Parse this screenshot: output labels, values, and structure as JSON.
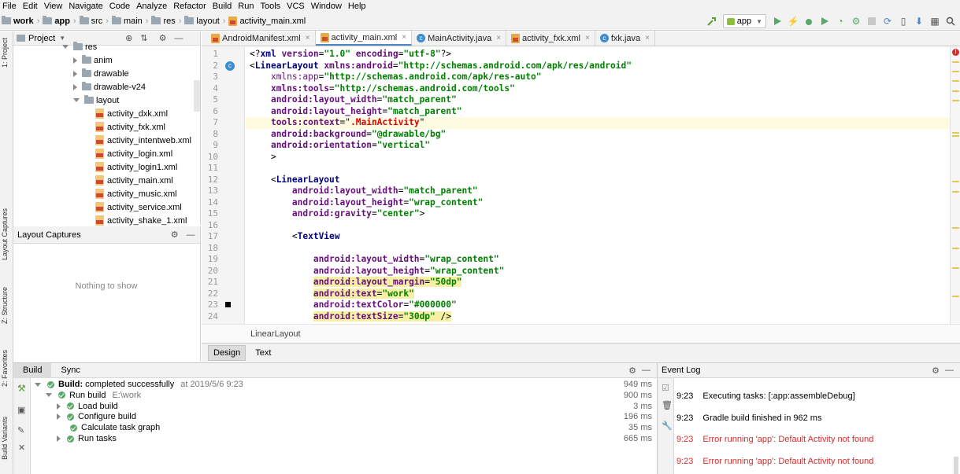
{
  "menu": [
    "File",
    "Edit",
    "View",
    "Navigate",
    "Code",
    "Analyze",
    "Refactor",
    "Build",
    "Run",
    "Tools",
    "VCS",
    "Window",
    "Help"
  ],
  "breadcrumbs": [
    "work",
    "app",
    "src",
    "main",
    "res",
    "layout",
    "activity_main.xml"
  ],
  "run_config": "app",
  "left_tool_tabs": [
    "1: Project",
    "Layout Captures",
    "Z: Structure",
    "2: Favorites",
    "Build Variants"
  ],
  "project": {
    "title": "Project",
    "tree": [
      {
        "label": "res",
        "indent": 0,
        "type": "folder",
        "state": "open"
      },
      {
        "label": "anim",
        "indent": 1,
        "type": "folder",
        "state": "closed"
      },
      {
        "label": "drawable",
        "indent": 1,
        "type": "folder",
        "state": "closed"
      },
      {
        "label": "drawable-v24",
        "indent": 1,
        "type": "folder",
        "state": "closed"
      },
      {
        "label": "layout",
        "indent": 1,
        "type": "folder",
        "state": "open"
      },
      {
        "label": "activity_dxk.xml",
        "indent": 2,
        "type": "file"
      },
      {
        "label": "activity_fxk.xml",
        "indent": 2,
        "type": "file"
      },
      {
        "label": "activity_intentweb.xml",
        "indent": 2,
        "type": "file"
      },
      {
        "label": "activity_login.xml",
        "indent": 2,
        "type": "file"
      },
      {
        "label": "activity_login1.xml",
        "indent": 2,
        "type": "file"
      },
      {
        "label": "activity_main.xml",
        "indent": 2,
        "type": "file"
      },
      {
        "label": "activity_music.xml",
        "indent": 2,
        "type": "file"
      },
      {
        "label": "activity_service.xml",
        "indent": 2,
        "type": "file"
      },
      {
        "label": "activity_shake_1.xml",
        "indent": 2,
        "type": "file"
      }
    ]
  },
  "captures": {
    "title": "Layout Captures",
    "empty_text": "Nothing to show"
  },
  "tabs": [
    {
      "label": "AndroidManifest.xml",
      "icon": "xml-icon",
      "active": false
    },
    {
      "label": "activity_main.xml",
      "icon": "xml-icon",
      "active": true
    },
    {
      "label": "MainActivity.java",
      "icon": "class-icon",
      "active": false
    },
    {
      "label": "activity_fxk.xml",
      "icon": "xml-icon",
      "active": false
    },
    {
      "label": "fxk.java",
      "icon": "class-icon",
      "active": false
    }
  ],
  "editor": {
    "line_numbers": [
      "1",
      "2",
      "3",
      "4",
      "5",
      "6",
      "7",
      "8",
      "9",
      "10",
      "11",
      "12",
      "13",
      "14",
      "15",
      "16",
      "17",
      "18",
      "19",
      "20",
      "21",
      "22",
      "23",
      "24"
    ],
    "lines": [
      [
        [
          "pl",
          "<?"
        ],
        [
          "tg",
          "xml "
        ],
        [
          "at",
          "version"
        ],
        [
          "pl",
          "="
        ],
        [
          "vl",
          "\"1.0\" "
        ],
        [
          "at",
          "encoding"
        ],
        [
          "pl",
          "="
        ],
        [
          "vl",
          "\"utf-8\""
        ],
        [
          "pl",
          "?>"
        ]
      ],
      [
        [
          "pl",
          "<"
        ],
        [
          "tg",
          "LinearLayout "
        ],
        [
          "at",
          "xmlns:android"
        ],
        [
          "pl",
          "="
        ],
        [
          "vl",
          "\"http://schemas.android.com/apk/res/android\""
        ]
      ],
      [
        [
          "pl",
          "    "
        ],
        [
          "ns",
          "xmlns:app"
        ],
        [
          "pl",
          "="
        ],
        [
          "vl",
          "\"http://schemas.android.com/apk/res-auto\""
        ]
      ],
      [
        [
          "pl",
          "    "
        ],
        [
          "at",
          "xmlns:tools"
        ],
        [
          "pl",
          "="
        ],
        [
          "vl",
          "\"http://schemas.android.com/tools\""
        ]
      ],
      [
        [
          "pl",
          "    "
        ],
        [
          "at",
          "android:layout_width"
        ],
        [
          "pl",
          "="
        ],
        [
          "vl",
          "\"match_parent\""
        ]
      ],
      [
        [
          "pl",
          "    "
        ],
        [
          "at",
          "android:layout_height"
        ],
        [
          "pl",
          "="
        ],
        [
          "vl",
          "\"match_parent\""
        ]
      ],
      [
        [
          "pl",
          "    "
        ],
        [
          "at",
          "tools:context"
        ],
        [
          "pl",
          "=\""
        ],
        [
          "red",
          ".MainActivity"
        ],
        [
          "pl",
          "\""
        ]
      ],
      [
        [
          "pl",
          "    "
        ],
        [
          "at",
          "android:background"
        ],
        [
          "pl",
          "="
        ],
        [
          "vl",
          "\"@drawable/bg\""
        ]
      ],
      [
        [
          "pl",
          "    "
        ],
        [
          "at",
          "android:orientation"
        ],
        [
          "pl",
          "="
        ],
        [
          "vl",
          "\"vertical\""
        ]
      ],
      [
        [
          "pl",
          "    >"
        ]
      ],
      [
        [
          "pl",
          ""
        ]
      ],
      [
        [
          "pl",
          "    <"
        ],
        [
          "tg",
          "LinearLayout"
        ]
      ],
      [
        [
          "pl",
          "        "
        ],
        [
          "at",
          "android:layout_width"
        ],
        [
          "pl",
          "="
        ],
        [
          "vl",
          "\"match_parent\""
        ]
      ],
      [
        [
          "pl",
          "        "
        ],
        [
          "at",
          "android:layout_height"
        ],
        [
          "pl",
          "="
        ],
        [
          "vl",
          "\"wrap_content\""
        ]
      ],
      [
        [
          "pl",
          "        "
        ],
        [
          "at",
          "android:gravity"
        ],
        [
          "pl",
          "="
        ],
        [
          "vl",
          "\"center\""
        ],
        [
          "pl",
          ">"
        ]
      ],
      [
        [
          "pl",
          ""
        ]
      ],
      [
        [
          "pl",
          "        <"
        ],
        [
          "tg",
          "TextView"
        ]
      ],
      [
        [
          "pl",
          ""
        ]
      ],
      [
        [
          "pl",
          "            "
        ],
        [
          "at",
          "android:layout_width"
        ],
        [
          "pl",
          "="
        ],
        [
          "vl",
          "\"wrap_content\""
        ]
      ],
      [
        [
          "pl",
          "            "
        ],
        [
          "at",
          "android:layout_height"
        ],
        [
          "pl",
          "="
        ],
        [
          "vl",
          "\"wrap_content\""
        ]
      ],
      [
        [
          "pl",
          "            "
        ],
        [
          "at",
          "android:layout_margin"
        ],
        [
          "pl",
          "="
        ],
        [
          "vl",
          "\"50dp\""
        ]
      ],
      [
        [
          "pl",
          "            "
        ],
        [
          "at",
          "android:text"
        ],
        [
          "pl",
          "="
        ],
        [
          "vl",
          "\"work\""
        ]
      ],
      [
        [
          "pl",
          "            "
        ],
        [
          "at",
          "android:textColor"
        ],
        [
          "pl",
          "="
        ],
        [
          "vl",
          "\"#000000\""
        ]
      ],
      [
        [
          "pl",
          "            "
        ],
        [
          "at",
          "android:textSize"
        ],
        [
          "pl",
          "="
        ],
        [
          "vl",
          "\"30dp\""
        ],
        [
          "pl",
          " />"
        ]
      ]
    ],
    "warning_lines": [
      21,
      22,
      24
    ],
    "caret_line": 7
  },
  "status_breadcrumb": "LinearLayout",
  "design_tabs": [
    {
      "label": "Design",
      "selected": true
    },
    {
      "label": "Text",
      "selected": false
    }
  ],
  "build": {
    "tabs": [
      {
        "label": "Build",
        "selected": true
      },
      {
        "label": "Sync",
        "selected": false
      }
    ],
    "rows": [
      {
        "label": "Build:",
        "rest": "completed successfully",
        "detail": "at 2019/5/6 9:23",
        "time": "949 ms",
        "indent": 0,
        "expand": "down",
        "ok": true,
        "bold": true
      },
      {
        "label": "Run build",
        "rest": "",
        "detail": "E:\\work",
        "time": "900 ms",
        "indent": 1,
        "expand": "down",
        "ok": true,
        "bold": false
      },
      {
        "label": "Load build",
        "rest": "",
        "detail": "",
        "time": "3 ms",
        "indent": 2,
        "expand": "right",
        "ok": true,
        "bold": false
      },
      {
        "label": "Configure build",
        "rest": "",
        "detail": "",
        "time": "196 ms",
        "indent": 2,
        "expand": "right",
        "ok": true,
        "bold": false
      },
      {
        "label": "Calculate task graph",
        "rest": "",
        "detail": "",
        "time": "35 ms",
        "indent": 2,
        "expand": "none",
        "ok": true,
        "bold": false
      },
      {
        "label": "Run tasks",
        "rest": "",
        "detail": "",
        "time": "665 ms",
        "indent": 2,
        "expand": "right",
        "ok": true,
        "bold": false
      }
    ]
  },
  "event_log": {
    "title": "Event Log",
    "entries": [
      {
        "time": "9:23",
        "text": "Executing tasks: [:app:assembleDebug]",
        "error": false
      },
      {
        "time": "9:23",
        "text": "Gradle build finished in 962 ms",
        "error": false
      },
      {
        "time": "9:23",
        "text": "Error running 'app': Default Activity not found",
        "error": true
      },
      {
        "time": "9:23",
        "text": "Error running 'app': Default Activity not found",
        "error": true
      }
    ]
  },
  "colors": {
    "accent": "#4a88c7",
    "ok": "#59a869",
    "error": "#d32f2f",
    "tag": "#000080",
    "attr": "#660e7a",
    "value": "#008000"
  }
}
